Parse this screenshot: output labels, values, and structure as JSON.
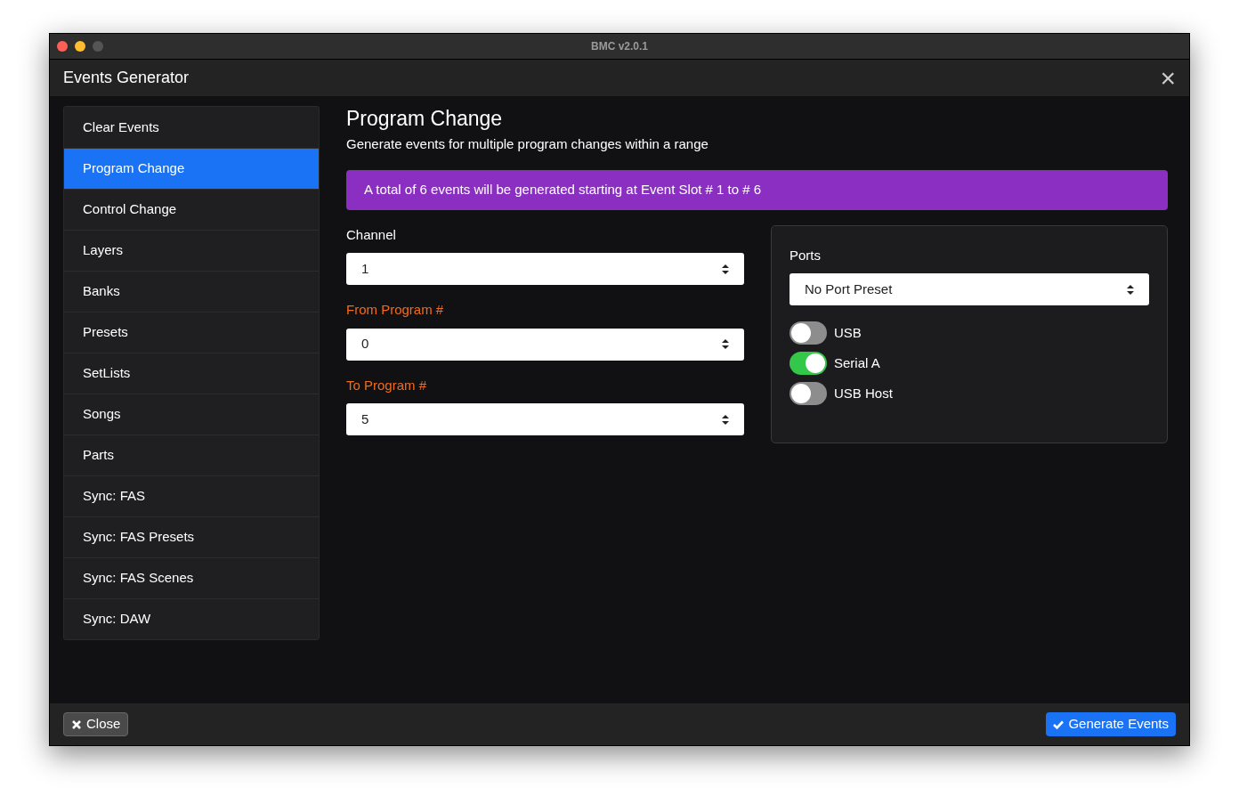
{
  "window": {
    "title": "BMC v2.0.1"
  },
  "dialog": {
    "title": "Events Generator",
    "close_symbol": "×"
  },
  "sidebar": {
    "items": [
      {
        "label": "Clear Events",
        "selected": false
      },
      {
        "label": "Program Change",
        "selected": true
      },
      {
        "label": "Control Change",
        "selected": false
      },
      {
        "label": "Layers",
        "selected": false
      },
      {
        "label": "Banks",
        "selected": false
      },
      {
        "label": "Presets",
        "selected": false
      },
      {
        "label": "SetLists",
        "selected": false
      },
      {
        "label": "Songs",
        "selected": false
      },
      {
        "label": "Parts",
        "selected": false
      },
      {
        "label": "Sync: FAS",
        "selected": false
      },
      {
        "label": "Sync: FAS Presets",
        "selected": false
      },
      {
        "label": "Sync: FAS Scenes",
        "selected": false
      },
      {
        "label": "Sync: DAW",
        "selected": false
      }
    ]
  },
  "content": {
    "title": "Program Change",
    "subtitle": "Generate events for multiple program changes within a range",
    "notice": "A total of 6 events will be generated starting at Event Slot # 1 to # 6",
    "fields": [
      {
        "label": "Channel",
        "highlighted": false,
        "value": "1"
      },
      {
        "label": "From Program #",
        "highlighted": true,
        "value": "0"
      },
      {
        "label": "To Program #",
        "highlighted": true,
        "value": "5"
      }
    ],
    "ports": {
      "title": "Ports",
      "preset": "No Port Preset",
      "toggles": [
        {
          "label": "USB",
          "on": false
        },
        {
          "label": "Serial A",
          "on": true
        },
        {
          "label": "USB Host",
          "on": false
        }
      ]
    }
  },
  "footer": {
    "buttons": [
      {
        "kind": "close",
        "label": "Close"
      },
      {
        "kind": "generate",
        "label": "Generate Events"
      }
    ]
  }
}
